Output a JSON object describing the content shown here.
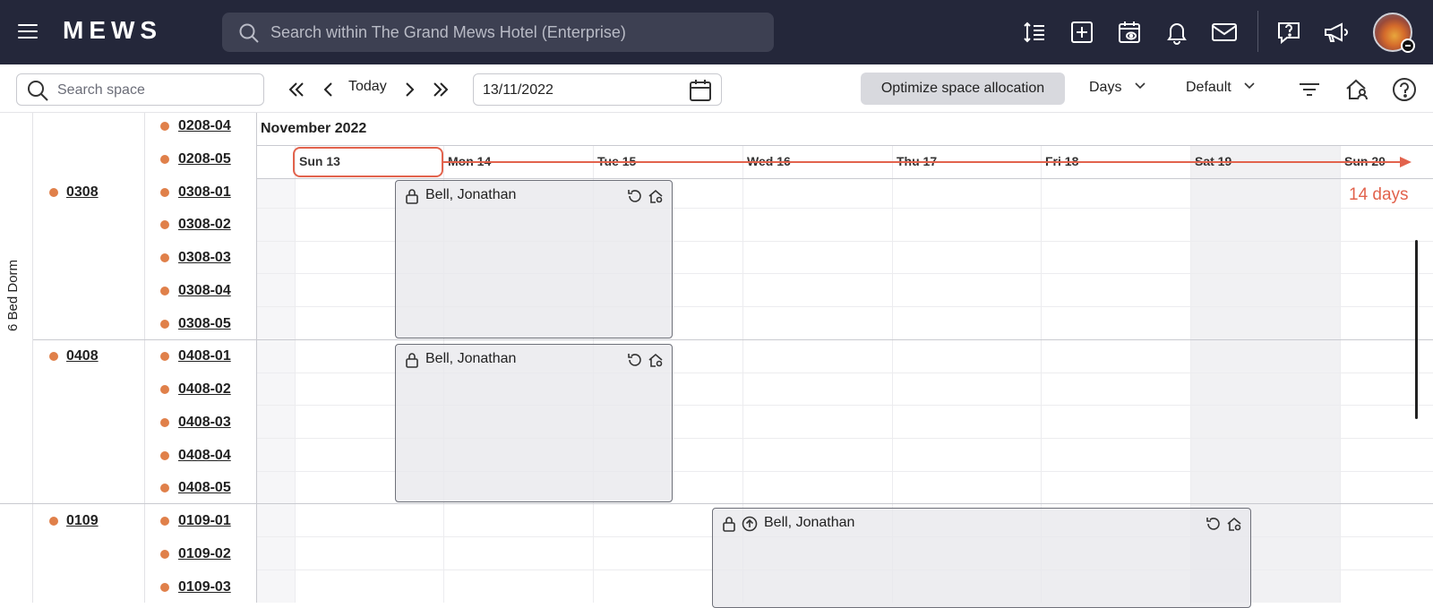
{
  "topbar": {
    "logo": "MEWS",
    "search_placeholder": "Search within The Grand Mews Hotel (Enterprise)",
    "icons": [
      "menu-icon",
      "sort-icon",
      "add-icon",
      "calendar-view-icon",
      "bell-icon",
      "mail-icon",
      "help-chat-icon",
      "megaphone-icon"
    ]
  },
  "toolbar": {
    "search_placeholder": "Search space",
    "today_label": "Today",
    "date_value": "13/11/2022",
    "optimize_label": "Optimize space allocation",
    "days_dropdown": "Days",
    "default_dropdown": "Default"
  },
  "timeline": {
    "month": "November 2022",
    "days": [
      "Sun 13",
      "Mon 14",
      "Tue 15",
      "Wed 16",
      "Thu 17",
      "Fri 18",
      "Sat 19",
      "Sun 20"
    ],
    "annotation": "14 days",
    "accent_color": "#e2634d"
  },
  "categories": [
    {
      "label": "6 Bed Dorm"
    }
  ],
  "rooms": {
    "room_0308": "0308",
    "room_0408": "0408",
    "room_0109": "0109",
    "beds": [
      "0208-04",
      "0208-05",
      "0308-01",
      "0308-02",
      "0308-03",
      "0308-04",
      "0308-05",
      "0408-01",
      "0408-02",
      "0408-03",
      "0408-04",
      "0408-05",
      "0109-01",
      "0109-02",
      "0109-03"
    ]
  },
  "bookings": [
    {
      "guest": "Bell, Jonathan"
    },
    {
      "guest": "Bell, Jonathan"
    },
    {
      "guest": "Bell, Jonathan"
    }
  ]
}
